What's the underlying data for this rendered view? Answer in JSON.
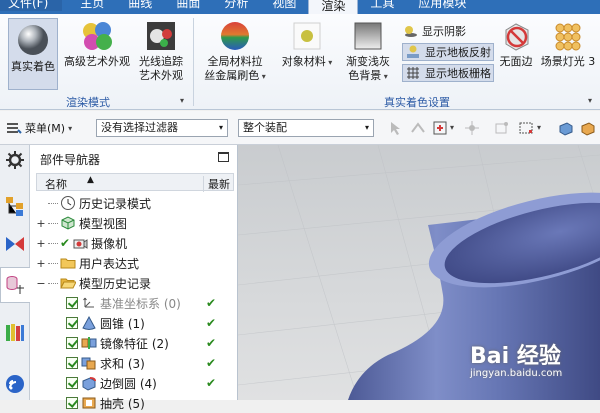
{
  "menubar": {
    "file": "文件(F)",
    "items": [
      "主页",
      "曲线",
      "曲面",
      "分析",
      "视图",
      "渲染",
      "工具",
      "应用模块"
    ],
    "active_index": 5
  },
  "ribbon": {
    "buttons": {
      "true_shading": "真实着色",
      "advanced_art": "高级艺术外观",
      "raytrace_1": "光线追踪",
      "raytrace_2": "艺术外观",
      "global_material_1": "全局材料拉",
      "global_material_2": "丝金属刷色",
      "object_material": "对象材料",
      "gradient_bg_1": "渐变浅灰",
      "gradient_bg_2": "色背景",
      "show_shadow": "显示阴影",
      "show_floor_reflection": "显示地板反射",
      "show_floor_grid": "显示地板栅格",
      "no_edges": "无面边",
      "scene_light": "场景灯光 3"
    },
    "groups": {
      "render_mode": "渲染模式",
      "true_shading_settings": "真实着色设置"
    }
  },
  "toolbar": {
    "menu_label": "菜单(M)",
    "filter_value": "没有选择过滤器",
    "assembly_value": "整个装配"
  },
  "navigator": {
    "title": "部件导航器",
    "col_name": "名称",
    "col_latest": "最新",
    "rows": [
      {
        "label": "历史记录模式"
      },
      {
        "label": "模型视图"
      },
      {
        "label": "摄像机"
      },
      {
        "label": "用户表达式"
      },
      {
        "label": "模型历史记录"
      },
      {
        "label": "基准坐标系 (0)"
      },
      {
        "label": "圆锥 (1)"
      },
      {
        "label": "镜像特征 (2)"
      },
      {
        "label": "求和 (3)"
      },
      {
        "label": "边倒圆 (4)"
      },
      {
        "label": "抽壳 (5)"
      }
    ]
  },
  "watermark": {
    "logo": "Bai 经验",
    "url": "jingyan.baidu.com"
  },
  "colors": {
    "menubar": "#2e6fb8",
    "accent_blue": "#2b5aa5",
    "check_green": "#2a8a1f",
    "model_blue": "#5d6da8"
  }
}
